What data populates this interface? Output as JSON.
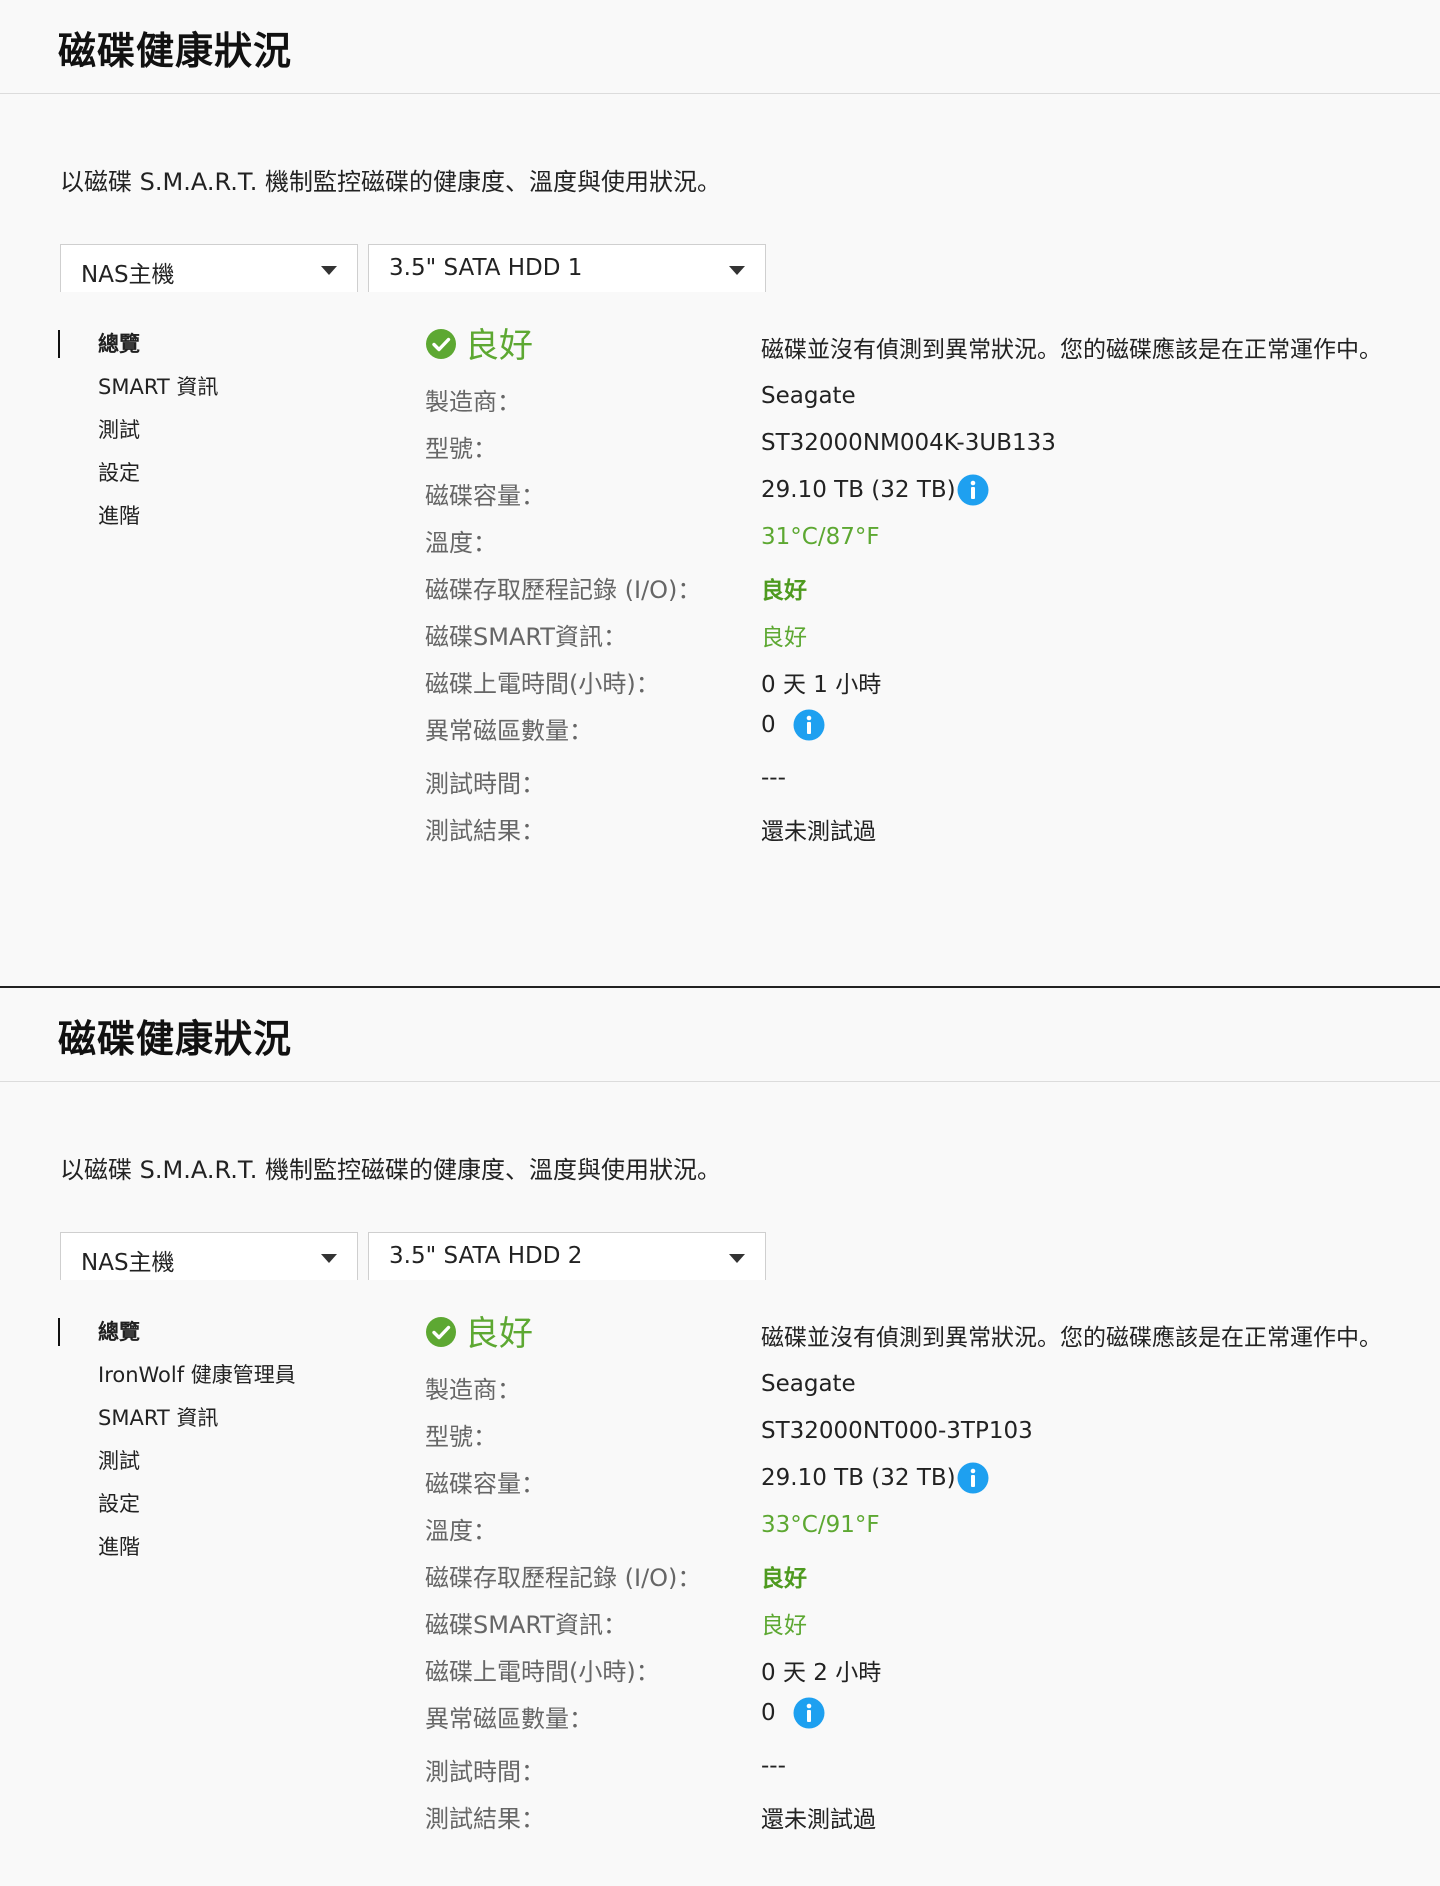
{
  "panels": [
    {
      "title": "磁碟健康狀況",
      "description": "以磁碟 S.M.A.R.T. 機制監控磁碟的健康度、溫度與使用狀況。",
      "host_select": "NAS主機",
      "disk_select": "3.5\" SATA HDD 1",
      "nav": [
        "總覽",
        "SMART 資訊",
        "測試",
        "設定",
        "進階"
      ],
      "status": "良好",
      "status_message": "磁碟並沒有偵測到異常狀況。您的磁碟應該是在正常運作中。",
      "rows": [
        {
          "label": "製造商：",
          "value": "Seagate"
        },
        {
          "label": "型號：",
          "value": "ST32000NM004K-3UB133"
        },
        {
          "label": "磁碟容量：",
          "value": "29.10 TB (32 TB)",
          "info": true
        },
        {
          "label": "溫度：",
          "value": "31°C/87°F",
          "style": "green"
        },
        {
          "label": "磁碟存取歷程記錄 (I/O)：",
          "value": "良好",
          "style": "green-bold"
        },
        {
          "label": "磁碟SMART資訊：",
          "value": "良好",
          "style": "green"
        },
        {
          "label": "磁碟上電時間(小時)：",
          "value": "0 天 1 小時"
        },
        {
          "label": "異常磁區數量：",
          "value": "0",
          "info": true
        },
        {
          "label": "測試時間：",
          "value": "---"
        },
        {
          "label": "測試結果：",
          "value": "還未測試過"
        }
      ]
    },
    {
      "title": "磁碟健康狀況",
      "description": "以磁碟 S.M.A.R.T. 機制監控磁碟的健康度、溫度與使用狀況。",
      "host_select": "NAS主機",
      "disk_select": "3.5\" SATA HDD 2",
      "nav": [
        "總覽",
        "IronWolf 健康管理員",
        "SMART 資訊",
        "測試",
        "設定",
        "進階"
      ],
      "status": "良好",
      "status_message": "磁碟並沒有偵測到異常狀況。您的磁碟應該是在正常運作中。",
      "rows": [
        {
          "label": "製造商：",
          "value": "Seagate"
        },
        {
          "label": "型號：",
          "value": "ST32000NT000-3TP103"
        },
        {
          "label": "磁碟容量：",
          "value": "29.10 TB (32 TB)",
          "info": true
        },
        {
          "label": "溫度：",
          "value": "33°C/91°F",
          "style": "green"
        },
        {
          "label": "磁碟存取歷程記錄 (I/O)：",
          "value": "良好",
          "style": "green-bold"
        },
        {
          "label": "磁碟SMART資訊：",
          "value": "良好",
          "style": "green"
        },
        {
          "label": "磁碟上電時間(小時)：",
          "value": "0 天 2 小時"
        },
        {
          "label": "異常磁區數量：",
          "value": "0",
          "info": true
        },
        {
          "label": "測試時間：",
          "value": "---"
        },
        {
          "label": "測試結果：",
          "value": "還未測試過"
        }
      ]
    }
  ],
  "colors": {
    "good": "#5da832",
    "info": "#1ea0f0",
    "check": "#5da832"
  },
  "icons": {
    "status": "check-circle-icon",
    "info": "info-icon"
  }
}
